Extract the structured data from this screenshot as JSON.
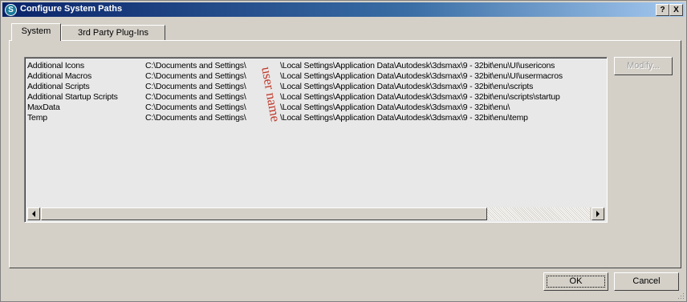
{
  "window": {
    "title": "Configure System Paths",
    "help_label": "?",
    "close_label": "X"
  },
  "tabs": [
    {
      "label": "System",
      "active": true
    },
    {
      "label": "3rd Party Plug-Ins",
      "active": false
    }
  ],
  "paths": [
    {
      "name": "Additional Icons",
      "prefix": "C:\\Documents and Settings\\",
      "suffix": "\\Local Settings\\Application Data\\Autodesk\\3dsmax\\9 - 32bit\\enu\\UI\\usericons"
    },
    {
      "name": "Additional Macros",
      "prefix": "C:\\Documents and Settings\\",
      "suffix": "\\Local Settings\\Application Data\\Autodesk\\3dsmax\\9 - 32bit\\enu\\UI\\usermacros"
    },
    {
      "name": "Additional Scripts",
      "prefix": "C:\\Documents and Settings\\",
      "suffix": "\\Local Settings\\Application Data\\Autodesk\\3dsmax\\9 - 32bit\\enu\\scripts"
    },
    {
      "name": "Additional Startup Scripts",
      "prefix": "C:\\Documents and Settings\\",
      "suffix": "\\Local Settings\\Application Data\\Autodesk\\3dsmax\\9 - 32bit\\enu\\scripts\\startup"
    },
    {
      "name": "MaxData",
      "prefix": "C:\\Documents and Settings\\",
      "suffix": "\\Local Settings\\Application Data\\Autodesk\\3dsmax\\9 - 32bit\\enu\\"
    },
    {
      "name": "Temp",
      "prefix": "C:\\Documents and Settings\\",
      "suffix": "\\Local Settings\\Application Data\\Autodesk\\3dsmax\\9 - 32bit\\enu\\temp"
    }
  ],
  "redaction_text": "user name",
  "buttons": {
    "modify": "Modify...",
    "ok": "OK",
    "cancel": "Cancel"
  },
  "colors": {
    "redaction": "#c0392b",
    "titlebar": "#0a246a"
  },
  "icons": {
    "title": "app-s-icon",
    "scroll_left": "arrow-left-icon",
    "scroll_right": "arrow-right-icon",
    "grip": "resize-grip-icon"
  }
}
